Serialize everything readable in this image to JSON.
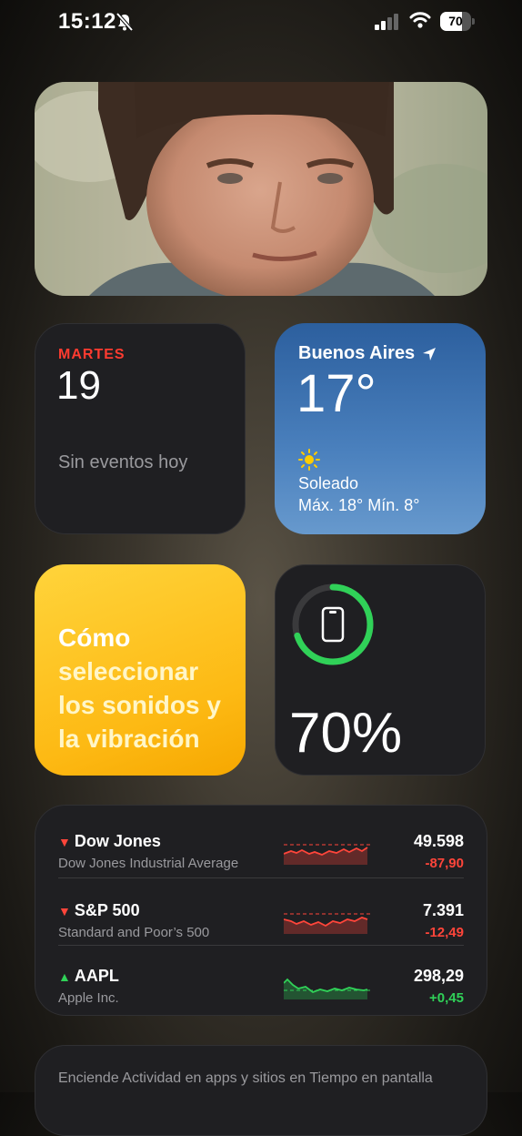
{
  "status_bar": {
    "time": "15:12",
    "battery_percent": "70",
    "battery_level": 0.7,
    "icons": [
      "bell-slash-icon",
      "cellular-signal-icon",
      "wifi-icon",
      "battery-icon"
    ]
  },
  "photo_widget": {
    "icon": "photo-person-portrait"
  },
  "calendar_widget": {
    "weekday": "MARTES",
    "day": "19",
    "events_text": "Sin eventos hoy",
    "accent_color": "#ff3b30"
  },
  "weather_widget": {
    "city": "Buenos Aires",
    "temperature": "17°",
    "condition": "Soleado",
    "range": "Máx. 18° Mín. 8°",
    "icons": [
      "location-arrow-icon",
      "sun-icon"
    ]
  },
  "tips_widget": {
    "line1": "Cómo",
    "rest": "seleccionar los sonidos y la vibración"
  },
  "battery_widget": {
    "percent_label": "70%",
    "level": 0.7,
    "ring_color": "#30d158",
    "icon": "iphone-icon"
  },
  "stocks_widget": {
    "rows": [
      {
        "symbol": "Dow Jones",
        "name": "Dow Jones Industrial Average",
        "price": "49.598",
        "change": "-87,90",
        "direction": "down"
      },
      {
        "symbol": "S&P 500",
        "name": "Standard and Poor’s 500",
        "price": "7.391",
        "change": "-12,49",
        "direction": "down"
      },
      {
        "symbol": "AAPL",
        "name": "Apple Inc.",
        "price": "298,29",
        "change": "+0,45",
        "direction": "up"
      }
    ],
    "down_color": "#ff453a",
    "up_color": "#30d158"
  },
  "activity_widget": {
    "text": "Enciende Actividad en apps y sitios en Tiempo en pantalla"
  }
}
